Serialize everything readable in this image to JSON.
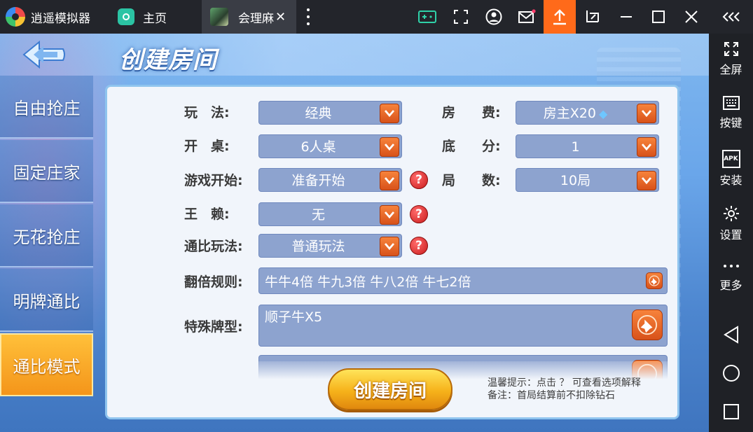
{
  "topbar": {
    "brand": "逍遥模拟器",
    "home_tab": "主页",
    "game_tab": "会理麻",
    "close_glyph": "✕"
  },
  "sidebar": {
    "fullscreen": "全屏",
    "keys": "按键",
    "install": "安装",
    "apk": "APK",
    "settings": "设置",
    "more": "更多"
  },
  "game": {
    "title": "创建房间",
    "menu": [
      "自由抢庄",
      "固定庄家",
      "无花抢庄",
      "明牌通比",
      "通比模式"
    ],
    "active_menu_index": 4,
    "fields": {
      "play_label": "玩　法:",
      "play_value": "经典",
      "fee_label": "房　　费:",
      "fee_value": "房主X20",
      "table_label": "开　桌:",
      "table_value": "6人桌",
      "base_label": "底　　分:",
      "base_value": "1",
      "start_label": "游戏开始:",
      "start_value": "准备开始",
      "rounds_label": "局　　数:",
      "rounds_value": "10局",
      "joker_label": "王　赖:",
      "joker_value": "无",
      "tongbi_label": "通比玩法:",
      "tongbi_value": "普通玩法",
      "double_label": "翻倍规则:",
      "double_value": "牛牛4倍 牛九3倍 牛八2倍 牛七2倍",
      "special_label": "特殊牌型:",
      "special_value": "顺子牛X5"
    },
    "help_glyph": "?",
    "create_button": "创建房间",
    "tip_line1": "温馨提示：点击 ？  可查看选项解释",
    "tip_line2": "备注：首局结算前不扣除钻石"
  },
  "colors": {
    "accent_orange": "#ff6a1a",
    "select_fill": "#8da3cf",
    "active_menu": "#f4951a"
  },
  "icons": [
    "search-icon",
    "gamepad-icon",
    "screenshot-icon",
    "user-icon",
    "mail-icon",
    "upload-icon",
    "crop-icon",
    "minimize-icon",
    "maximize-icon",
    "close-icon",
    "collapse-icon",
    "fullscreen-icon",
    "keyboard-icon",
    "apk-icon",
    "gear-icon",
    "more-icon",
    "back-triangle-icon",
    "home-circle-icon",
    "recent-square-icon",
    "pin-icon",
    "chevron-down-icon",
    "diamond-icon"
  ]
}
